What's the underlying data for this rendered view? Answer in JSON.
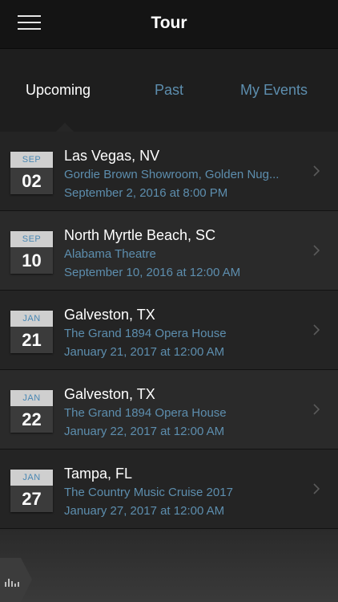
{
  "header": {
    "title": "Tour",
    "menu_icon": "hamburger-menu-icon"
  },
  "tabs": [
    {
      "label": "Upcoming",
      "active": true
    },
    {
      "label": "Past",
      "active": false
    },
    {
      "label": "My Events",
      "active": false
    }
  ],
  "events": [
    {
      "month": "SEP",
      "day": "02",
      "city": "Las Vegas, NV",
      "venue": "Gordie Brown Showroom, Golden Nug...",
      "datetime": "September 2, 2016 at 8:00 PM"
    },
    {
      "month": "SEP",
      "day": "10",
      "city": "North Myrtle Beach, SC",
      "venue": "Alabama Theatre",
      "datetime": "September 10, 2016 at 12:00 AM"
    },
    {
      "month": "JAN",
      "day": "21",
      "city": "Galveston, TX",
      "venue": "The Grand 1894 Opera House",
      "datetime": "January 21, 2017 at 12:00 AM"
    },
    {
      "month": "JAN",
      "day": "22",
      "city": "Galveston, TX",
      "venue": "The Grand 1894 Opera House",
      "datetime": "January 22, 2017 at 12:00 AM"
    },
    {
      "month": "JAN",
      "day": "27",
      "city": "Tampa, FL",
      "venue": "The Country Music Cruise 2017",
      "datetime": "January 27, 2017 at 12:00 AM"
    }
  ],
  "player": {
    "icon": "equalizer-icon"
  },
  "colors": {
    "accent": "#5d8eae",
    "background": "#1c1c1c",
    "header": "#141414"
  }
}
